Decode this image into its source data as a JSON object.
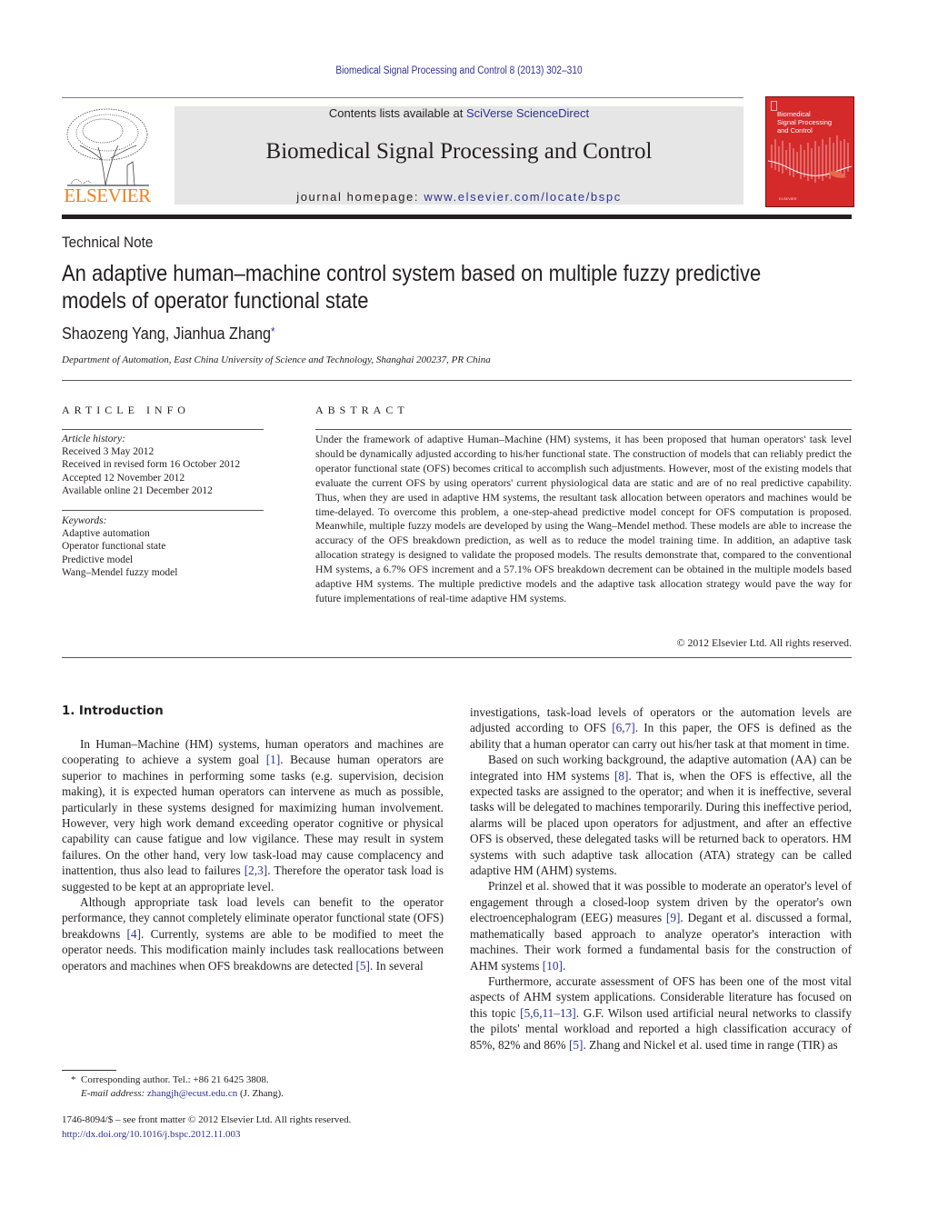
{
  "running_head": "Biomedical Signal Processing and Control 8 (2013) 302–310",
  "publisher": {
    "logo_word": "ELSEVIER",
    "logo_color": "#f07f19"
  },
  "banner": {
    "contents_prefix": "Contents lists available at ",
    "contents_link": "SciVerse ScienceDirect",
    "journal_title": "Biomedical Signal Processing and Control",
    "homepage_prefix": "journal homepage: ",
    "homepage_link": "www.elsevier.com/locate/bspc"
  },
  "cover": {
    "line1": "Biomedical",
    "line2": "Signal Processing",
    "line3": "and Control",
    "color": "#d42a2a"
  },
  "article": {
    "type": "Technical Note",
    "title": "An adaptive human–machine control system based on multiple fuzzy predictive models of operator functional state",
    "authors": "Shaozeng Yang, Jianhua Zhang",
    "author_mark": "*",
    "affiliation": "Department of Automation, East China University of Science and Technology, Shanghai 200237, PR China"
  },
  "article_info": {
    "label": "ARTICLE INFO",
    "history_label": "Article history:",
    "history": [
      "Received 3 May 2012",
      "Received in revised form 16 October 2012",
      "Accepted 12 November 2012",
      "Available online 21 December 2012"
    ],
    "keywords_label": "Keywords:",
    "keywords": [
      "Adaptive automation",
      "Operator functional state",
      "Predictive model",
      "Wang–Mendel fuzzy model"
    ]
  },
  "abstract": {
    "label": "ABSTRACT",
    "text": "Under the framework of adaptive Human–Machine (HM) systems, it has been proposed that human operators' task level should be dynamically adjusted according to his/her functional state. The construction of models that can reliably predict the operator functional state (OFS) becomes critical to accomplish such adjustments. However, most of the existing models that evaluate the current OFS by using operators' current physiological data are static and are of no real predictive capability. Thus, when they are used in adaptive HM systems, the resultant task allocation between operators and machines would be time-delayed. To overcome this problem, a one-step-ahead predictive model concept for OFS computation is proposed. Meanwhile, multiple fuzzy models are developed by using the Wang–Mendel method. These models are able to increase the accuracy of the OFS breakdown prediction, as well as to reduce the model training time. In addition, an adaptive task allocation strategy is designed to validate the proposed models. The results demonstrate that, compared to the conventional HM systems, a 6.7% OFS increment and a 57.1% OFS breakdown decrement can be obtained in the multiple models based adaptive HM systems. The multiple predictive models and the adaptive task allocation strategy would pave the way for future implementations of real-time adaptive HM systems.",
    "copyright": "© 2012 Elsevier Ltd. All rights reserved."
  },
  "introduction": {
    "heading": "1.  Introduction",
    "left_paragraphs": [
      {
        "parts": [
          {
            "t": "In Human–Machine (HM) systems, human operators and machines are cooperating to achieve a system goal "
          },
          {
            "ref": "[1]"
          },
          {
            "t": ". Because human operators are superior to machines in performing some tasks (e.g. supervision, decision making), it is expected human operators can intervene as much as possible, particularly in these systems designed for maximizing human involvement. However, very high work demand exceeding operator cognitive or physical capability can cause fatigue and low vigilance. These may result in system failures. On the other hand, very low task-load may cause complacency and inattention, thus also lead to failures "
          },
          {
            "ref": "[2,3]"
          },
          {
            "t": ". Therefore the operator task load is suggested to be kept at an appropriate level."
          }
        ]
      },
      {
        "parts": [
          {
            "t": "Although appropriate task load levels can benefit to the operator performance, they cannot completely eliminate operator functional state (OFS) breakdowns "
          },
          {
            "ref": "[4]"
          },
          {
            "t": ". Currently, systems are able to be modified to meet the operator needs. This modification mainly includes task reallocations between operators and machines when OFS breakdowns are detected "
          },
          {
            "ref": "[5]"
          },
          {
            "t": ". In several"
          }
        ]
      }
    ],
    "right_paragraphs": [
      {
        "noindent": true,
        "parts": [
          {
            "t": "investigations, task-load levels of operators or the automation levels are adjusted according to OFS "
          },
          {
            "ref": "[6,7]"
          },
          {
            "t": ". In this paper, the OFS is defined as the ability that a human operator can carry out his/her task at that moment in time."
          }
        ]
      },
      {
        "parts": [
          {
            "t": "Based on such working background, the adaptive automation (AA) can be integrated into HM systems "
          },
          {
            "ref": "[8]"
          },
          {
            "t": ". That is, when the OFS is effective, all the expected tasks are assigned to the operator; and when it is ineffective, several tasks will be delegated to machines temporarily. During this ineffective period, alarms will be placed upon operators for adjustment, and after an effective OFS is observed, these delegated tasks will be returned back to operators. HM systems with such adaptive task allocation (ATA) strategy can be called adaptive HM (AHM) systems."
          }
        ]
      },
      {
        "parts": [
          {
            "t": "Prinzel et al. showed that it was possible to moderate an operator's level of engagement through a closed-loop system driven by the operator's own electroencephalogram (EEG) measures "
          },
          {
            "ref": "[9]"
          },
          {
            "t": ". Degant et al. discussed a formal, mathematically based approach to analyze operator's interaction with machines. Their work formed a fundamental basis for the construction of AHM systems "
          },
          {
            "ref": "[10]"
          },
          {
            "t": "."
          }
        ]
      },
      {
        "parts": [
          {
            "t": "Furthermore, accurate assessment of OFS has been one of the most vital aspects of AHM system applications. Considerable literature has focused on this topic "
          },
          {
            "ref": "[5,6,11–13]"
          },
          {
            "t": ". G.F. Wilson used artificial neural networks to classify the pilots' mental workload and reported a high classification accuracy of 85%, 82% and 86% "
          },
          {
            "ref": "[5]"
          },
          {
            "t": ". Zhang and Nickel et al. used time in range (TIR) as"
          }
        ]
      }
    ]
  },
  "footnote": {
    "mark": "*",
    "corresponding": "Corresponding author. Tel.: +86 21 6425 3808.",
    "email_label": "E-mail address: ",
    "email": "zhangjh@ecust.edu.cn",
    "email_suffix": " (J. Zhang)."
  },
  "front_matter": {
    "issn_line": "1746-8094/$ – see front matter © 2012 Elsevier Ltd. All rights reserved.",
    "doi": "http://dx.doi.org/10.1016/j.bspc.2012.11.003"
  },
  "link_color": "#2e3192"
}
